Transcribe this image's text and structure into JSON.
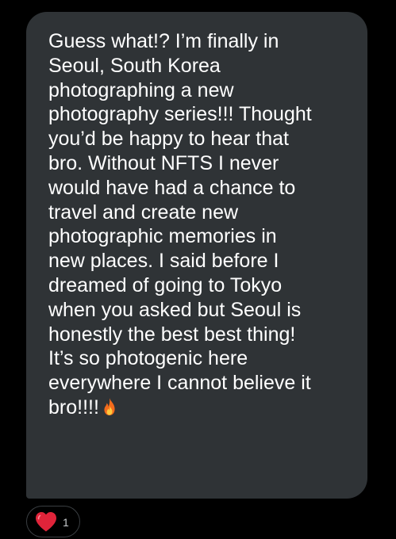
{
  "message": {
    "text_lines": [
      "Guess what!? I’m finally in",
      "Seoul, South Korea",
      "photographing a new",
      "photography series!!! Thought",
      "you’d be happy to hear that",
      "bro. Without NFTS I never",
      "would have had a chance to",
      "travel and create new",
      "photographic memories in",
      "new places. I said before I",
      "dreamed of going to Tokyo",
      "when you asked but Seoul is",
      "honestly the best best thing!",
      "It’s so photogenic here",
      "everywhere I cannot believe it",
      "bro!!!!"
    ],
    "emoji": "fire-icon",
    "bubble_color": "#2f3336",
    "text_color": "#ffffff"
  },
  "reaction": {
    "icon": "heart-icon",
    "count": "1",
    "heart_color": "#e0243a"
  },
  "background_color": "#000000"
}
